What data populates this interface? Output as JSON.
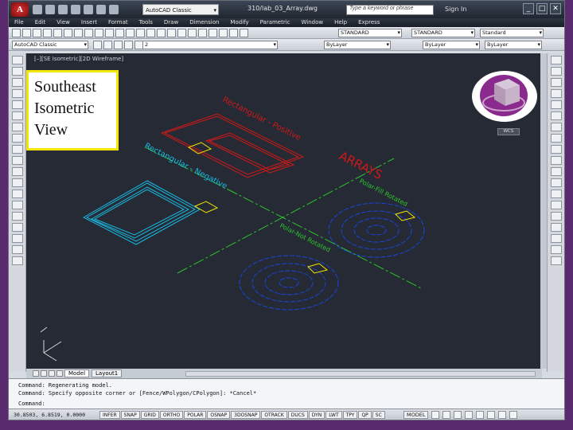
{
  "window": {
    "app_button": "A",
    "workspace": "AutoCAD Classic",
    "document_title": "310/lab_03_Array.dwg",
    "search_placeholder": "Type a keyword or phrase",
    "sign_in": "Sign In"
  },
  "menu": [
    "File",
    "Edit",
    "View",
    "Insert",
    "Format",
    "Tools",
    "Draw",
    "Dimension",
    "Modify",
    "Parametric",
    "Window",
    "Help",
    "Express"
  ],
  "toolbar2": {
    "text_style": "STANDARD",
    "dim_style": "STANDARD",
    "table_style": "Standard"
  },
  "toolbar3": {
    "workspace_combo": "AutoCAD Classic",
    "layer": "2",
    "color": "ByLayer",
    "linetype": "ByLayer",
    "lineweight": "ByLayer"
  },
  "viewport": {
    "label": "[–][SE Isometric][2D Wireframe]",
    "wcs": "WCS",
    "drawing_texts": {
      "rect_positive": "Rectangular - Positive",
      "rect_negative": "Rectangular - Negative",
      "arrays": "ARRAYS",
      "polar_fill": "Polar-Fill Rotated",
      "polar_not": "Polar-Not Rotated"
    }
  },
  "tabs": {
    "model": "Model",
    "layout1": "Layout1"
  },
  "command": {
    "line1": "Command:  Regenerating model.",
    "line2": "Command: Specify opposite corner or [Fence/WPolygon/CPolygon]: *Cancel*",
    "prompt": "Command:"
  },
  "status": {
    "coords": "30.8503, 6.8519, 0.0000",
    "toggles": [
      "INFER",
      "SNAP",
      "GRID",
      "ORTHO",
      "POLAR",
      "OSNAP",
      "3DOSNAP",
      "OTRACK",
      "DUCS",
      "DYN",
      "LWT",
      "TPY",
      "QP",
      "SC"
    ],
    "model": "MODEL"
  },
  "callout": {
    "line1": "Southeast",
    "line2": "Isometric",
    "line3": "View"
  },
  "colors": {
    "viewport_bg": "#252a34",
    "red_lines": "#d01818",
    "cyan_lines": "#18b8e0",
    "blue_lines": "#1a45d8",
    "green_lines": "#2ec42e",
    "yellow": "#f3e600",
    "desktop": "#5a2a6e"
  }
}
